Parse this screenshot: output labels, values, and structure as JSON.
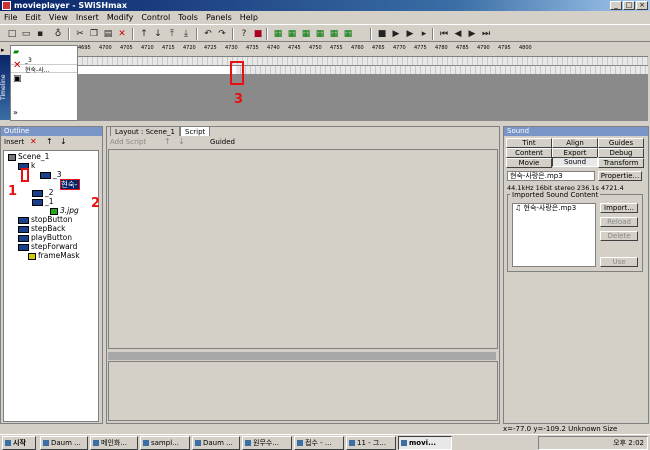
{
  "window": {
    "title": "movieplayer - SWiSHmax"
  },
  "menu": [
    "File",
    "Edit",
    "View",
    "Insert",
    "Modify",
    "Control",
    "Tools",
    "Panels",
    "Help"
  ],
  "timeline": {
    "side_label": "Timeline",
    "ruler": [
      "4695",
      "4700",
      "4705",
      "4710",
      "4715",
      "4720",
      "4725",
      "4730",
      "4735",
      "4740",
      "4745",
      "4750",
      "4755",
      "4760",
      "4765",
      "4770",
      "4775",
      "4780",
      "4785",
      "4790",
      "4795",
      "4800"
    ],
    "layers": [
      "_3",
      "현숙-사..."
    ],
    "marker_label": "3"
  },
  "outline": {
    "header": "Outline",
    "insert_label": "Insert",
    "items": [
      {
        "label": "Scene_1"
      },
      {
        "label": "k"
      },
      {
        "label": "_3"
      },
      {
        "label": "현숙-"
      },
      {
        "label": "_2"
      },
      {
        "label": "_1"
      },
      {
        "label": "3.jpg"
      },
      {
        "label": "stopButton"
      },
      {
        "label": "stepBack"
      },
      {
        "label": "playButton"
      },
      {
        "label": "stepForward"
      },
      {
        "label": "frameMask"
      }
    ],
    "marker1": "1",
    "marker2": "2"
  },
  "center": {
    "tabs": [
      "Layout : Scene_1",
      "Script"
    ],
    "add_script": "Add Script",
    "guided": "Guided"
  },
  "sound": {
    "header": "Sound",
    "tabs_row1": [
      "Tint",
      "Align",
      "Guides"
    ],
    "tabs_row2": [
      "Content",
      "Export",
      "Debug"
    ],
    "tabs_row3": [
      "Movie",
      "Sound",
      "Transform"
    ],
    "file": "현숙-사랑은.mp3",
    "properties_btn": "Propertie...",
    "info": "44.1kHz 16bit stereo 236.1s 4721.4",
    "group_label": "Imported Sound Content",
    "list_item": "현숙-사랑은.mp3",
    "import_btn": "Import...",
    "reload_btn": "Reload",
    "delete_btn": "Delete",
    "use_btn": "Use"
  },
  "status": {
    "coords": "x=-77.0 y=-109.2",
    "size": "Unknown Size"
  },
  "taskbar": {
    "start": "시작",
    "tasks": [
      "Daum ...",
      "메인화...",
      "sampl...",
      "Daum ...",
      "원무수...",
      "접수 - ...",
      "11 - 그...",
      "movi..."
    ],
    "clock": "오후 2:02"
  }
}
